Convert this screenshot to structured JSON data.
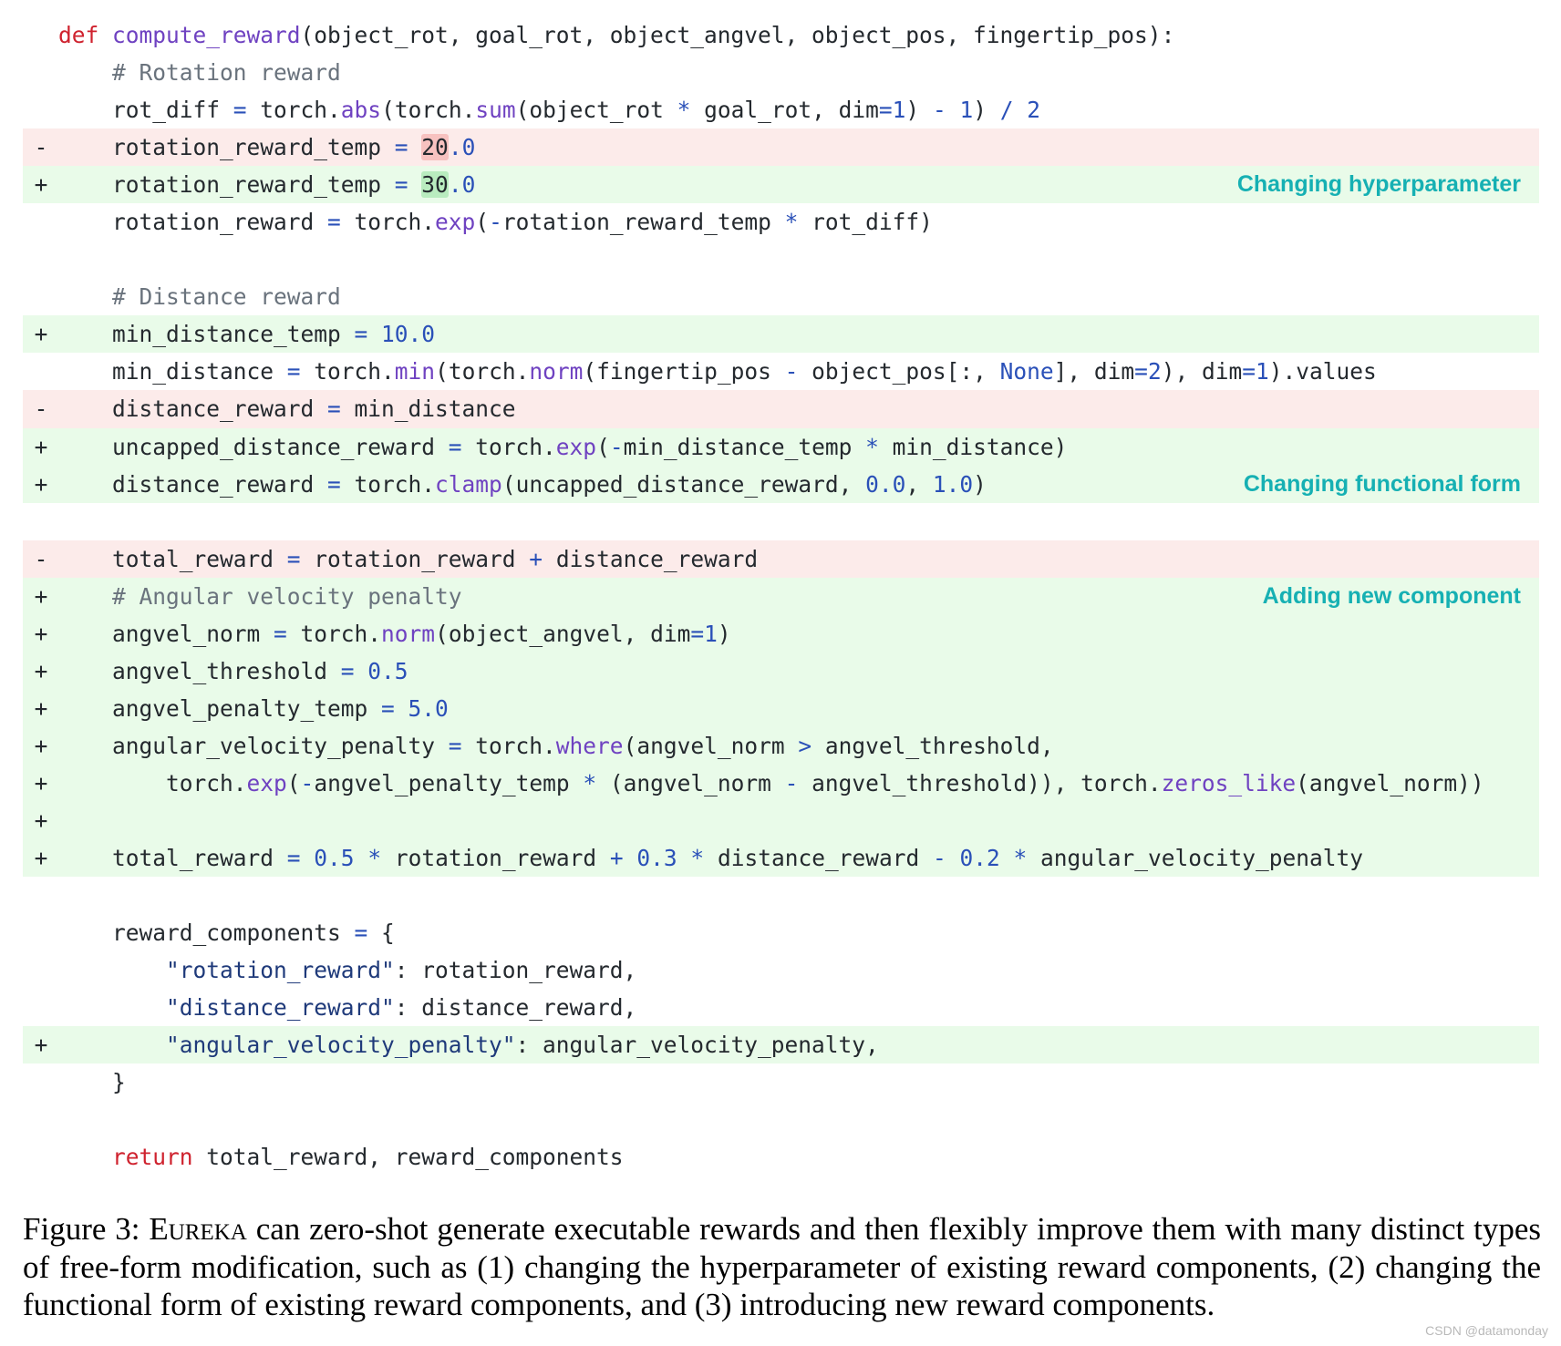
{
  "code_lines": [
    {
      "type": "ctx",
      "marker": "",
      "tokens": [
        [
          "kw",
          "def"
        ],
        [
          "",
          " "
        ],
        [
          "fn",
          "compute_reward"
        ],
        [
          "",
          "(object_rot, goal_rot, object_angvel, object_pos, fingertip_pos):"
        ]
      ]
    },
    {
      "type": "ctx",
      "marker": "",
      "tokens": [
        [
          "",
          "    "
        ],
        [
          "cm",
          "# Rotation reward"
        ]
      ]
    },
    {
      "type": "ctx",
      "marker": "",
      "tokens": [
        [
          "",
          "    rot_diff "
        ],
        [
          "op",
          "="
        ],
        [
          "",
          " torch."
        ],
        [
          "fn",
          "abs"
        ],
        [
          "",
          "(torch."
        ],
        [
          "fn",
          "sum"
        ],
        [
          "",
          "(object_rot "
        ],
        [
          "op",
          "*"
        ],
        [
          "",
          " goal_rot, dim"
        ],
        [
          "op",
          "="
        ],
        [
          "num",
          "1"
        ],
        [
          "",
          ") "
        ],
        [
          "op",
          "-"
        ],
        [
          "",
          " "
        ],
        [
          "num",
          "1"
        ],
        [
          "",
          ") "
        ],
        [
          "op",
          "/"
        ],
        [
          "",
          " "
        ],
        [
          "num",
          "2"
        ]
      ]
    },
    {
      "type": "del",
      "marker": "-",
      "tokens": [
        [
          "",
          "    rotation_reward_temp "
        ],
        [
          "op",
          "="
        ],
        [
          "",
          " "
        ],
        [
          "hldel",
          "20"
        ],
        [
          "num",
          ".0"
        ]
      ]
    },
    {
      "type": "add",
      "marker": "+",
      "tokens": [
        [
          "",
          "    rotation_reward_temp "
        ],
        [
          "op",
          "="
        ],
        [
          "",
          " "
        ],
        [
          "hladd",
          "30"
        ],
        [
          "num",
          ".0"
        ]
      ],
      "annotation": "Changing hyperparameter"
    },
    {
      "type": "ctx",
      "marker": "",
      "tokens": [
        [
          "",
          "    rotation_reward "
        ],
        [
          "op",
          "="
        ],
        [
          "",
          " torch."
        ],
        [
          "fn",
          "exp"
        ],
        [
          "",
          "("
        ],
        [
          "op",
          "-"
        ],
        [
          "",
          "rotation_reward_temp "
        ],
        [
          "op",
          "*"
        ],
        [
          "",
          " rot_diff)"
        ]
      ]
    },
    {
      "type": "ctx",
      "marker": "",
      "tokens": []
    },
    {
      "type": "ctx",
      "marker": "",
      "tokens": [
        [
          "",
          "    "
        ],
        [
          "cm",
          "# Distance reward"
        ]
      ]
    },
    {
      "type": "add",
      "marker": "+",
      "tokens": [
        [
          "",
          "    min_distance_temp "
        ],
        [
          "op",
          "="
        ],
        [
          "",
          " "
        ],
        [
          "num",
          "10.0"
        ]
      ]
    },
    {
      "type": "ctx",
      "marker": "",
      "tokens": [
        [
          "",
          "    min_distance "
        ],
        [
          "op",
          "="
        ],
        [
          "",
          " torch."
        ],
        [
          "fn",
          "min"
        ],
        [
          "",
          "(torch."
        ],
        [
          "fn",
          "norm"
        ],
        [
          "",
          "(fingertip_pos "
        ],
        [
          "op",
          "-"
        ],
        [
          "",
          " object_pos[:, "
        ],
        [
          "num",
          "None"
        ],
        [
          "",
          "], dim"
        ],
        [
          "op",
          "="
        ],
        [
          "num",
          "2"
        ],
        [
          "",
          "), dim"
        ],
        [
          "op",
          "="
        ],
        [
          "num",
          "1"
        ],
        [
          "",
          ").values"
        ]
      ]
    },
    {
      "type": "del",
      "marker": "-",
      "tokens": [
        [
          "",
          "    distance_reward "
        ],
        [
          "op",
          "="
        ],
        [
          "",
          " min_distance"
        ]
      ]
    },
    {
      "type": "add",
      "marker": "+",
      "tokens": [
        [
          "",
          "    uncapped_distance_reward "
        ],
        [
          "op",
          "="
        ],
        [
          "",
          " torch."
        ],
        [
          "fn",
          "exp"
        ],
        [
          "",
          "("
        ],
        [
          "op",
          "-"
        ],
        [
          "",
          "min_distance_temp "
        ],
        [
          "op",
          "*"
        ],
        [
          "",
          " min_distance)"
        ]
      ]
    },
    {
      "type": "add",
      "marker": "+",
      "tokens": [
        [
          "",
          "    distance_reward "
        ],
        [
          "op",
          "="
        ],
        [
          "",
          " torch."
        ],
        [
          "fn",
          "clamp"
        ],
        [
          "",
          "(uncapped_distance_reward, "
        ],
        [
          "num",
          "0.0"
        ],
        [
          "",
          ", "
        ],
        [
          "num",
          "1.0"
        ],
        [
          "",
          ")"
        ]
      ],
      "annotation": "Changing functional form"
    },
    {
      "type": "ctx",
      "marker": "",
      "tokens": []
    },
    {
      "type": "del",
      "marker": "-",
      "tokens": [
        [
          "",
          "    total_reward "
        ],
        [
          "op",
          "="
        ],
        [
          "",
          " rotation_reward "
        ],
        [
          "op",
          "+"
        ],
        [
          "",
          " distance_reward"
        ]
      ]
    },
    {
      "type": "add",
      "marker": "+",
      "tokens": [
        [
          "",
          "    "
        ],
        [
          "cm",
          "# Angular velocity penalty"
        ]
      ],
      "annotation": "Adding new component"
    },
    {
      "type": "add",
      "marker": "+",
      "tokens": [
        [
          "",
          "    angvel_norm "
        ],
        [
          "op",
          "="
        ],
        [
          "",
          " torch."
        ],
        [
          "fn",
          "norm"
        ],
        [
          "",
          "(object_angvel, dim"
        ],
        [
          "op",
          "="
        ],
        [
          "num",
          "1"
        ],
        [
          "",
          ")"
        ]
      ]
    },
    {
      "type": "add",
      "marker": "+",
      "tokens": [
        [
          "",
          "    angvel_threshold "
        ],
        [
          "op",
          "="
        ],
        [
          "",
          " "
        ],
        [
          "num",
          "0.5"
        ]
      ]
    },
    {
      "type": "add",
      "marker": "+",
      "tokens": [
        [
          "",
          "    angvel_penalty_temp "
        ],
        [
          "op",
          "="
        ],
        [
          "",
          " "
        ],
        [
          "num",
          "5.0"
        ]
      ]
    },
    {
      "type": "add",
      "marker": "+",
      "tokens": [
        [
          "",
          "    angular_velocity_penalty "
        ],
        [
          "op",
          "="
        ],
        [
          "",
          " torch."
        ],
        [
          "fn",
          "where"
        ],
        [
          "",
          "(angvel_norm "
        ],
        [
          "op",
          ">"
        ],
        [
          "",
          " angvel_threshold,"
        ]
      ]
    },
    {
      "type": "add",
      "marker": "+",
      "tokens": [
        [
          "",
          "        torch."
        ],
        [
          "fn",
          "exp"
        ],
        [
          "",
          "("
        ],
        [
          "op",
          "-"
        ],
        [
          "",
          "angvel_penalty_temp "
        ],
        [
          "op",
          "*"
        ],
        [
          "",
          " (angvel_norm "
        ],
        [
          "op",
          "-"
        ],
        [
          "",
          " angvel_threshold)), torch."
        ],
        [
          "fn",
          "zeros_like"
        ],
        [
          "",
          "(angvel_norm))"
        ]
      ]
    },
    {
      "type": "add",
      "marker": "+",
      "tokens": []
    },
    {
      "type": "add",
      "marker": "+",
      "tokens": [
        [
          "",
          "    total_reward "
        ],
        [
          "op",
          "="
        ],
        [
          "",
          " "
        ],
        [
          "num",
          "0.5"
        ],
        [
          "",
          " "
        ],
        [
          "op",
          "*"
        ],
        [
          "",
          " rotation_reward "
        ],
        [
          "op",
          "+"
        ],
        [
          "",
          " "
        ],
        [
          "num",
          "0.3"
        ],
        [
          "",
          " "
        ],
        [
          "op",
          "*"
        ],
        [
          "",
          " distance_reward "
        ],
        [
          "op",
          "-"
        ],
        [
          "",
          " "
        ],
        [
          "num",
          "0.2"
        ],
        [
          "",
          " "
        ],
        [
          "op",
          "*"
        ],
        [
          "",
          " angular_velocity_penalty"
        ]
      ]
    },
    {
      "type": "ctx",
      "marker": "",
      "tokens": []
    },
    {
      "type": "ctx",
      "marker": "",
      "tokens": [
        [
          "",
          "    reward_components "
        ],
        [
          "op",
          "="
        ],
        [
          "",
          " {"
        ]
      ]
    },
    {
      "type": "ctx",
      "marker": "",
      "tokens": [
        [
          "",
          "        "
        ],
        [
          "str",
          "\"rotation_reward\""
        ],
        [
          "",
          ": rotation_reward,"
        ]
      ]
    },
    {
      "type": "ctx",
      "marker": "",
      "tokens": [
        [
          "",
          "        "
        ],
        [
          "str",
          "\"distance_reward\""
        ],
        [
          "",
          ": distance_reward,"
        ]
      ]
    },
    {
      "type": "add",
      "marker": "+",
      "tokens": [
        [
          "",
          "        "
        ],
        [
          "str",
          "\"angular_velocity_penalty\""
        ],
        [
          "",
          ": angular_velocity_penalty,"
        ]
      ]
    },
    {
      "type": "ctx",
      "marker": "",
      "tokens": [
        [
          "",
          "    }"
        ]
      ]
    },
    {
      "type": "ctx",
      "marker": "",
      "tokens": []
    },
    {
      "type": "ctx",
      "marker": "",
      "tokens": [
        [
          "",
          "    "
        ],
        [
          "kw",
          "return"
        ],
        [
          "",
          " total_reward, reward_components"
        ]
      ]
    }
  ],
  "caption": {
    "prefix": "Figure 3: ",
    "name": "Eureka",
    "text": " can zero-shot generate executable rewards and then flexibly improve them with many distinct types of free-form modification, such as (1) changing the hyperparameter of existing reward components, (2) changing the functional form of existing reward components, and (3) introducing new reward components."
  },
  "watermark": "CSDN @datamonday",
  "colors": {
    "added_bg": "#e9fbe9",
    "removed_bg": "#fcebea",
    "annotation": "#16b0b3",
    "keyword": "#cf222e",
    "function": "#6f42c1",
    "number": "#2a50b8"
  }
}
